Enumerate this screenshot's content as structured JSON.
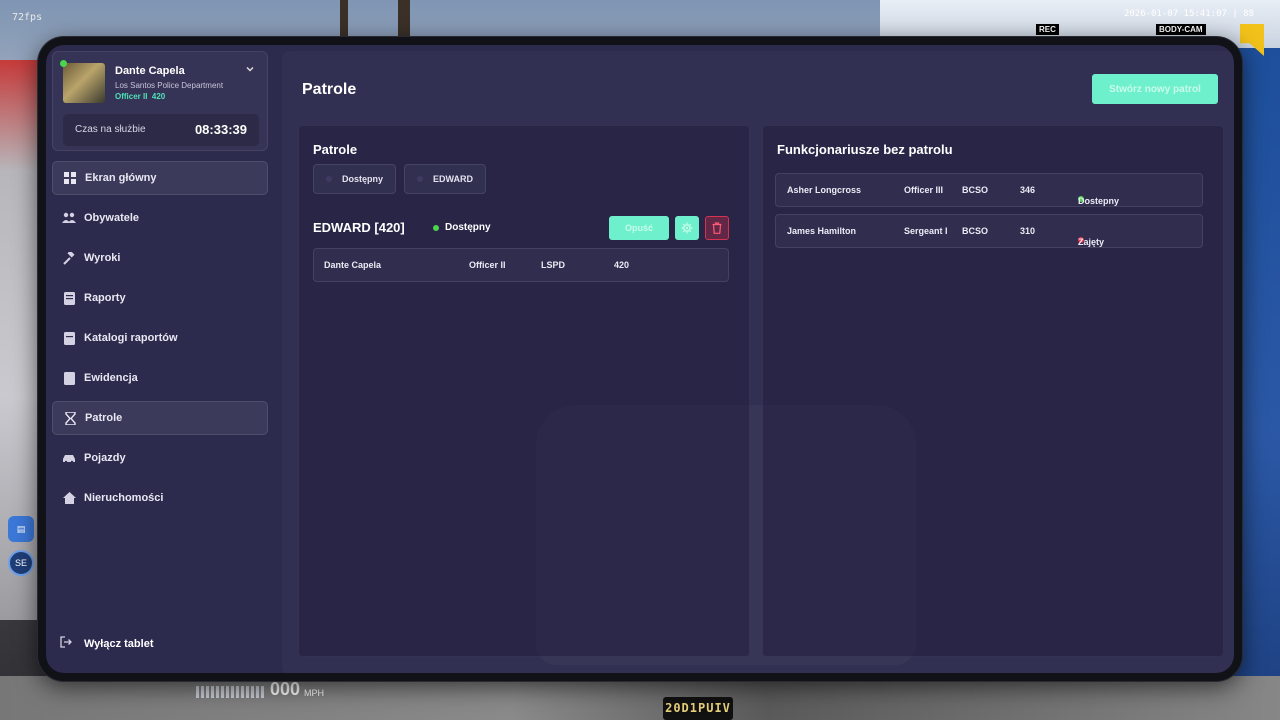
{
  "hud": {
    "fps": "72fps",
    "timestamp": "2026-01-07 15:41:07 | 88",
    "rec": "REC",
    "bodycam": "BODY-CAM",
    "speed_value": "000",
    "speed_unit": "MPH",
    "plate": "20D1PUIV",
    "side_label": "SE"
  },
  "profile": {
    "name": "Dante Capela",
    "department": "Los Santos Police Department",
    "rank": "Officer II",
    "badge": "420",
    "duty_label": "Czas na służbie",
    "duty_time": "08:33:39"
  },
  "sidebar": {
    "items": [
      {
        "label": "Ekran główny",
        "icon": "grid-icon"
      },
      {
        "label": "Obywatele",
        "icon": "users-icon"
      },
      {
        "label": "Wyroki",
        "icon": "gavel-icon"
      },
      {
        "label": "Raporty",
        "icon": "report-icon"
      },
      {
        "label": "Katalogi raportów",
        "icon": "folder-icon"
      },
      {
        "label": "Ewidencja",
        "icon": "evidence-icon"
      },
      {
        "label": "Patrole",
        "icon": "hourglass-icon"
      },
      {
        "label": "Pojazdy",
        "icon": "car-icon"
      },
      {
        "label": "Nieruchomości",
        "icon": "house-icon"
      }
    ],
    "active": "Patrole",
    "logout_label": "Wyłącz tablet"
  },
  "main": {
    "title": "Patrole",
    "create_button": "Stwórz nowy patrol"
  },
  "patrols_panel": {
    "title": "Patrole",
    "filters": [
      "Dostępny",
      "EDWARD"
    ],
    "patrol": {
      "name": "EDWARD [420]",
      "status": "Dostępny",
      "status_color": "#4cd44c",
      "leave_label": "Opuść",
      "members": [
        {
          "name": "Dante Capela",
          "rank": "Officer II",
          "dept": "LSPD",
          "badge": "420"
        }
      ]
    }
  },
  "free_panel": {
    "title": "Funkcjonariusze bez patrolu",
    "officers": [
      {
        "name": "Asher Longcross",
        "rank": "Officer III",
        "dept": "BCSO",
        "badge": "346",
        "status": "Dostepny",
        "status_color": "#4cd44c"
      },
      {
        "name": "James Hamilton",
        "rank": "Sergeant I",
        "dept": "BCSO",
        "badge": "310",
        "status": "Zajęty",
        "status_color": "#e0364f"
      }
    ]
  },
  "colors": {
    "accent": "#6ff0cc",
    "rank_accent": "#4ee2b6",
    "danger": "#d6334f"
  }
}
